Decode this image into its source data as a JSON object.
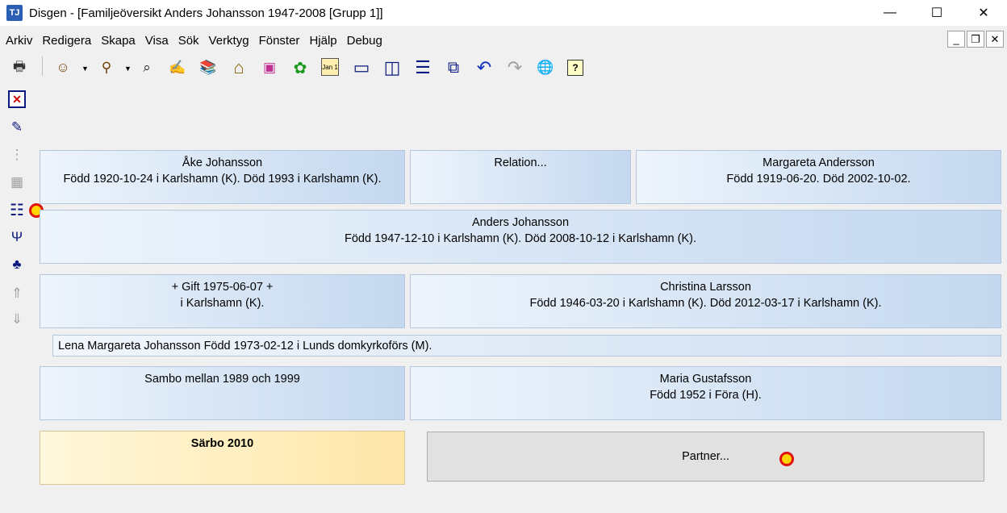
{
  "window": {
    "title": "Disgen - [Familjeöversikt Anders Johansson 1947-2008 [Grupp 1]]",
    "app_icon": "TJ",
    "controls": {
      "minimize": "—",
      "maximize": "☐",
      "close": "✕"
    }
  },
  "menu": [
    "Arkiv",
    "Redigera",
    "Skapa",
    "Visa",
    "Sök",
    "Verktyg",
    "Fönster",
    "Hjälp",
    "Debug"
  ],
  "mdi_controls": {
    "minimize": "_",
    "restore": "❐",
    "close": "✕"
  },
  "toolbar_icons": {
    "print": "🖶",
    "person": "☺",
    "person_search": "⚲",
    "binoculars": "⌕",
    "handshake": "✍",
    "books": "📚",
    "home": "⌂",
    "notes": "▣",
    "map": "✿",
    "calendar": "Jan 1",
    "window_single": "▭",
    "window_vertical": "◫",
    "window_horizontal": "☰",
    "window_cascade": "⧉",
    "undo": "↶",
    "redo": "↷",
    "globe": "🌐",
    "help": "?"
  },
  "side_icons": {
    "close_view": "✕",
    "edit_doc": "✎",
    "tree_indent": "⋮",
    "tree_grid": "▦",
    "family_view": "☷",
    "ancestor_tree": "Ψ",
    "descendant_tree": "♣",
    "go_up": "⇑",
    "go_down": "⇓"
  },
  "father": {
    "name": "Åke Johansson",
    "info": "Född 1920-10-24 i Karlshamn (K). Död 1993 i Karlshamn (K)."
  },
  "parents_relation": {
    "label": "Relation..."
  },
  "mother": {
    "name": "Margareta Andersson",
    "info": "Född 1919-06-20. Död 2002-10-02."
  },
  "main_person": {
    "name": "Anders Johansson",
    "info": "Född 1947-12-10 i Karlshamn (K). Död 2008-10-12 i Karlshamn (K)."
  },
  "marriage1": {
    "line1": "+ Gift 1975-06-07 +",
    "line2": "i  Karlshamn (K)."
  },
  "spouse1": {
    "name": "Christina Larsson",
    "info": "Född 1946-03-20 i Karlshamn (K). Död 2012-03-17 i Karlshamn (K)."
  },
  "child1": {
    "text": "Lena Margareta Johansson Född 1973-02-12 i Lunds domkyrkoförs (M)."
  },
  "relation2": {
    "text": "Sambo mellan 1989 och 1999"
  },
  "spouse2": {
    "name": "Maria Gustafsson",
    "info": "Född 1952 i Föra (H)."
  },
  "relation3": {
    "text": "Särbo 2010"
  },
  "partner_button": {
    "label": "Partner..."
  }
}
